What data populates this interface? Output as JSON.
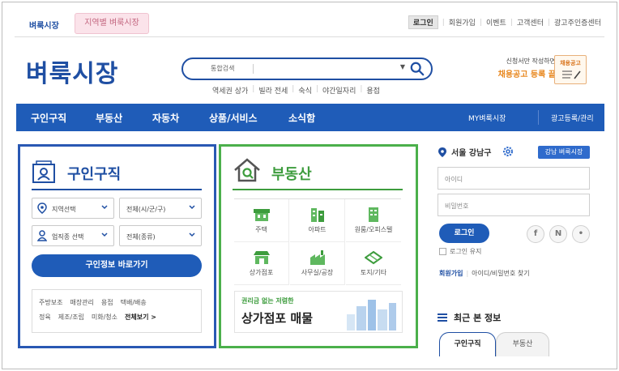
{
  "top_tabs": {
    "active": "벼룩시장",
    "regional": "지역별 벼룩시장"
  },
  "utility": [
    "로그인",
    "회원가입",
    "이벤트",
    "고객센터",
    "광고주인증센터"
  ],
  "logo": "벼룩시장",
  "search": {
    "category": "통합검색",
    "icon": "search-icon"
  },
  "keywords": [
    "역세권 상가",
    "빌라 전세",
    "숙식",
    "야간일자리",
    "용접"
  ],
  "promo": {
    "line1": "신청서만 작성하면",
    "line2": "채용공고 등록 끝",
    "badge": "채용공고"
  },
  "nav": {
    "items": [
      "구인구직",
      "부동산",
      "자동차",
      "상품/서비스",
      "소식함"
    ],
    "right": [
      "MY벼룩시장",
      "광고등록/관리"
    ]
  },
  "job": {
    "title": "구인구직",
    "region_select": "지역선택",
    "district_select": "전체(시/군/구)",
    "type_select": "업직종 선택",
    "all_type_select": "전체(종류)",
    "go_button": "구인정보 바로가기",
    "tags_row1": [
      "주방보조",
      "매장관리",
      "용접",
      "택배/배송"
    ],
    "tags_row2": [
      "정육",
      "제조/조립",
      "미화/청소"
    ],
    "more": "전체보기 >"
  },
  "realestate": {
    "title": "부동산",
    "categories": [
      "주택",
      "아파트",
      "원룸/오피스텔",
      "상가점포",
      "사무실/공장",
      "토지/기타"
    ],
    "banner_small": "권리금 없는 저렴한",
    "banner_big": "상가점포 매물"
  },
  "side": {
    "location": "서울 강남구",
    "city_button": "강남 벼룩시장",
    "id_placeholder": "아이디",
    "pw_placeholder": "비밀번호",
    "login_button": "로그인",
    "social": [
      "f",
      "N",
      "•"
    ],
    "keep_login": "로그인 유지",
    "join": "회원가입",
    "find": "아이디/비밀번호 찾기",
    "recent_title": "최근 본 정보",
    "recent_tabs": [
      "구인구직",
      "부동산"
    ]
  },
  "colors": {
    "brand_blue": "#1f4fa3",
    "nav_blue": "#1f5cb8",
    "green": "#3d9c3d",
    "accent_orange": "#e8871e"
  }
}
